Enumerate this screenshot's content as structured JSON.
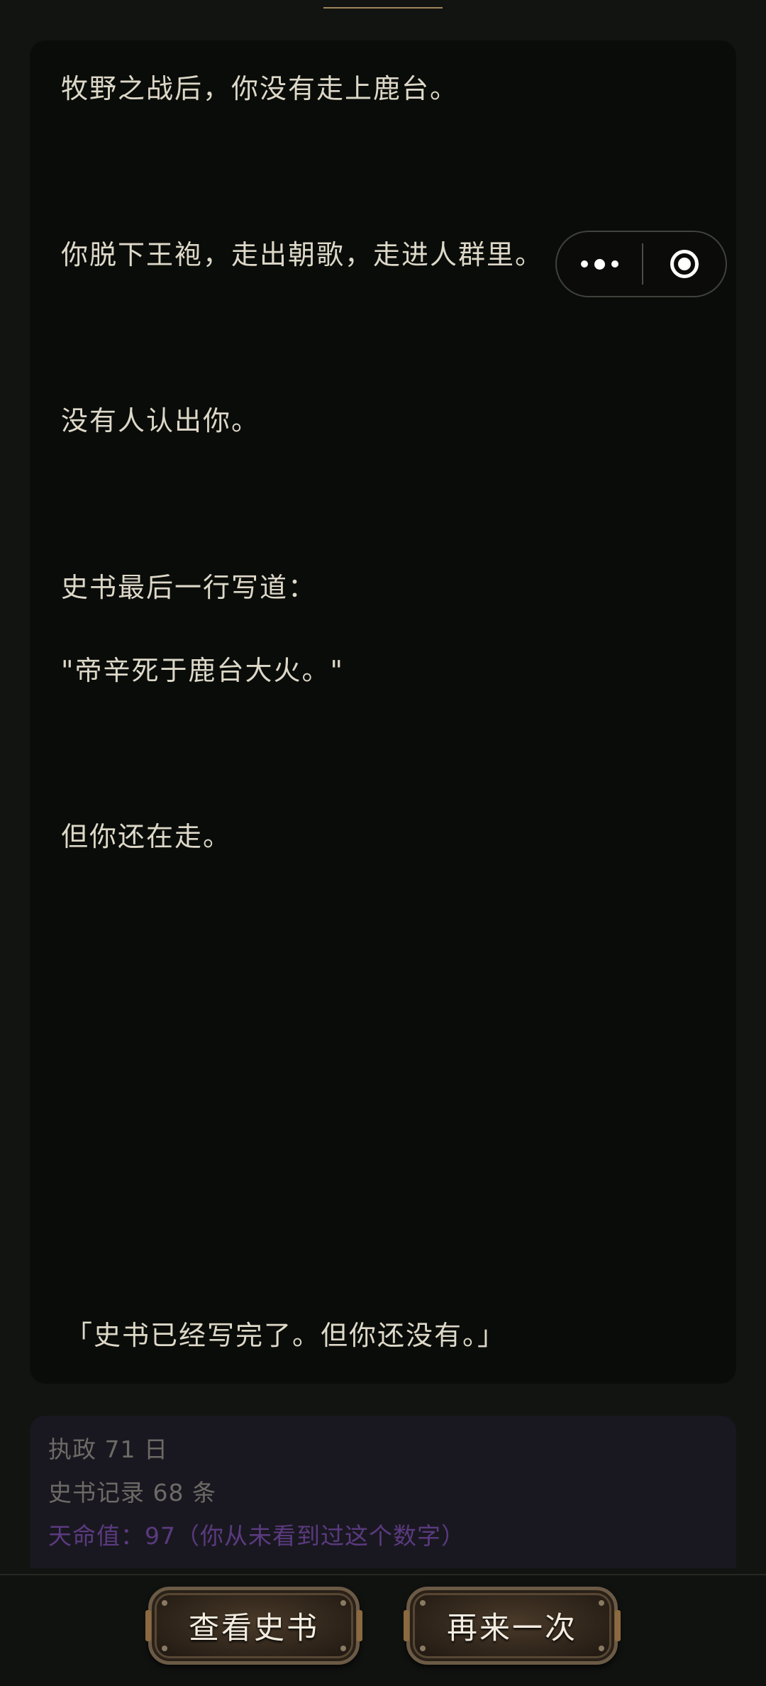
{
  "story": {
    "lines": [
      "牧野之战后，你没有走上鹿台。",
      "你脱下王袍，走出朝歌，走进人群里。",
      "没有人认出你。",
      "史书最后一行写道：",
      "\"帝辛死于鹿台大火。\"",
      "但你还在走。",
      "「史书已经写完了。但你还没有。」"
    ]
  },
  "capsule": {
    "more_icon": "more-dots-icon",
    "close_icon": "target-close-icon"
  },
  "stats": {
    "reign": "执政 71 日",
    "records": "史书记录 68 条",
    "mandate": "天命值：97（你从未看到过这个数字）"
  },
  "actions": {
    "view_history": "查看史书",
    "retry": "再来一次"
  },
  "colors": {
    "background": "#121411",
    "card": "#0a0c09",
    "text": "#ddd8c8",
    "mandate": "#5b3a80",
    "accent_line": "#b89a68"
  }
}
